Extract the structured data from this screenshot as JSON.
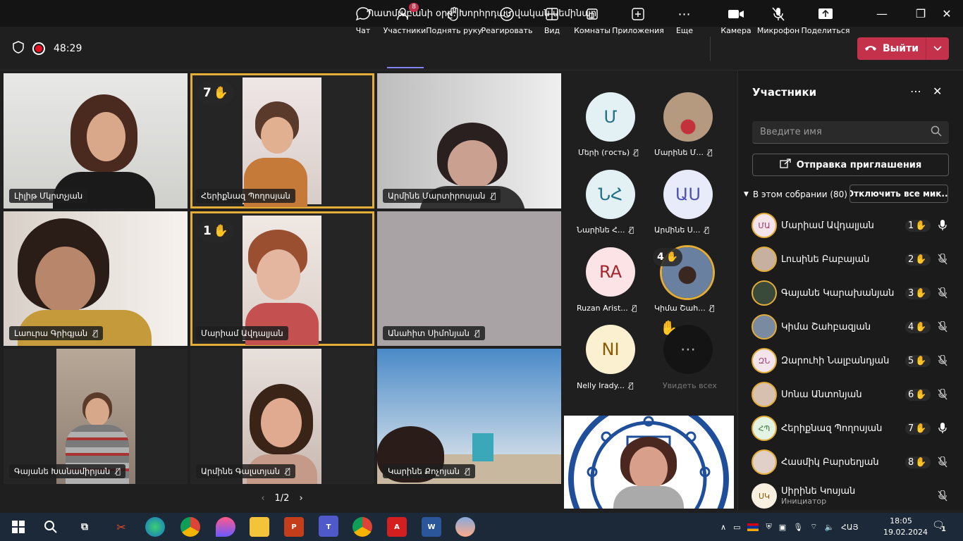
{
  "window": {
    "title": "Պատմաբանի օրը: Խորհրդատվական սեմինար"
  },
  "toolbar": {
    "timer": "48:29",
    "chat_label": "Чат",
    "participants_label": "Участники",
    "participants_badge": "8",
    "raise_hand_label": "Поднять руку",
    "react_label": "Реагировать",
    "view_label": "Вид",
    "rooms_label": "Комнаты",
    "apps_label": "Приложения",
    "more_label": "Еще",
    "camera_label": "Камера",
    "mic_label": "Микрофон",
    "share_label": "Поделиться",
    "leave_label": "Выйти"
  },
  "grid": {
    "tiles": [
      {
        "name": "Լիլիթ Մկրտչյան"
      },
      {
        "name": "Հերիքնազ Պողոսյան",
        "hand": "7"
      },
      {
        "name": "Արմինե Մարտիրոսյան"
      },
      {
        "name": "Լաուրա Գրիգյան"
      },
      {
        "name": "Մարիամ Ավդալյան",
        "hand": "1"
      },
      {
        "name": "Անահիտ Սիմոնյան"
      },
      {
        "name": "Գայանե Խանամիրյան"
      },
      {
        "name": "Արմինե Գալստյան"
      },
      {
        "name": "Կարինե Քոչոյան"
      }
    ],
    "page": "1/2"
  },
  "rail": {
    "items": [
      {
        "initials": "Մ",
        "name": "Մերի (гость)"
      },
      {
        "initials": "",
        "name": "Մարինե Մ..."
      },
      {
        "initials": "ՆՀ",
        "name": "Նարինե Հ..."
      },
      {
        "initials": "ԱՍ",
        "name": "Արմինե Ս..."
      },
      {
        "initials": "RA",
        "name": "Ruzan Arist..."
      },
      {
        "initials": "",
        "name": "Կիմա Շահ...",
        "hand": "4"
      },
      {
        "initials": "NI",
        "name": "Nelly Irady..."
      },
      {
        "initials": "",
        "name": "Увидеть всех"
      }
    ]
  },
  "panel": {
    "title": "Участники",
    "search_placeholder": "Введите имя",
    "invite_label": "Отправка приглашения",
    "in_meeting": "В этом собрании (80)",
    "mute_all": "Отключить все мик...",
    "people": [
      {
        "initials": "ՄԱ",
        "name": "Մարիամ Ավդալյան",
        "hand": "1",
        "mic": "on"
      },
      {
        "initials": "",
        "name": "Լուսինե Բաբայան",
        "hand": "2",
        "mic": "off"
      },
      {
        "initials": "",
        "name": "Գայանե Կարախանյան",
        "hand": "3",
        "mic": "off"
      },
      {
        "initials": "",
        "name": "Կիմա Շահբազյան",
        "hand": "4",
        "mic": "off"
      },
      {
        "initials": "ԶՆ",
        "name": "Զարուհի Նալբանդյան",
        "hand": "5",
        "mic": "off"
      },
      {
        "initials": "",
        "name": "Սոնա Անտոնյան",
        "hand": "6",
        "mic": "off"
      },
      {
        "initials": "ՀՊ",
        "name": "Հերիքնազ Պողոսյան",
        "hand": "7",
        "mic": "on"
      },
      {
        "initials": "",
        "name": "Հասմիկ Բարսեղյան",
        "hand": "8",
        "mic": "off"
      },
      {
        "initials": "ՍԿ",
        "name": "Սիրինե Կոսյան",
        "sub": "Инициатор",
        "mic": "off"
      }
    ]
  },
  "taskbar": {
    "lang": "ՀԱՅ",
    "time": "18:05",
    "date": "19.02.2024",
    "notifications": "1"
  }
}
